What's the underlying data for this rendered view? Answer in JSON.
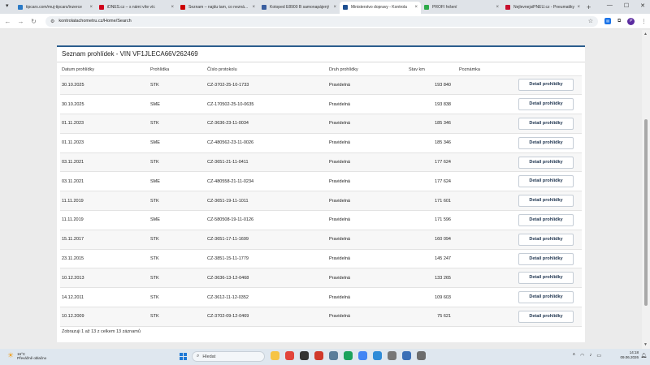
{
  "browser": {
    "tabs": [
      {
        "title": "tipcars.com/muj-tipcars/inzerce",
        "color": "#2a7ac6"
      },
      {
        "title": "iDNES.cz – s námi víte víc",
        "color": "#d0021b"
      },
      {
        "title": "Seznam – najdu tam, co nezná...",
        "color": "#cc0000"
      },
      {
        "title": "Kotoped E8900 B samonapájený",
        "color": "#3a5fa0"
      },
      {
        "title": "Ministerstvo dopravy - Kontrola",
        "color": "#1d4f91"
      },
      {
        "title": "PROFI řešení",
        "color": "#2eaa4a"
      },
      {
        "title": "NejlevnejsiPNEU.cz - Pneumatiky",
        "color": "#c8102e"
      }
    ],
    "url": "kontrolatachometru.cz/Home/Search",
    "profile_initial": "P"
  },
  "panel": {
    "title": "Seznam prohlídek - VIN VF1JLECA66V262469",
    "columns": [
      "Datum prohlídky",
      "Prohlídka",
      "Číslo protokolu",
      "Druh prohlídky",
      "Stav km",
      "Poznámka",
      ""
    ],
    "rows": [
      {
        "date": "30.10.2025",
        "type": "STK",
        "protocol": "CZ-3702-25-10-1733",
        "kind": "Pravidelná",
        "km": "193 840",
        "note": "",
        "action": "Detail prohlídky"
      },
      {
        "date": "30.10.2025",
        "type": "SME",
        "protocol": "CZ-170502-25-10-0635",
        "kind": "Pravidelná",
        "km": "193 838",
        "note": "",
        "action": "Detail prohlídky"
      },
      {
        "date": "01.11.2023",
        "type": "STK",
        "protocol": "CZ-3636-23-11-0034",
        "kind": "Pravidelná",
        "km": "185 346",
        "note": "",
        "action": "Detail prohlídky"
      },
      {
        "date": "01.11.2023",
        "type": "SME",
        "protocol": "CZ-480562-23-11-0026",
        "kind": "Pravidelná",
        "km": "185 346",
        "note": "",
        "action": "Detail prohlídky"
      },
      {
        "date": "03.11.2021",
        "type": "STK",
        "protocol": "CZ-3651-21-11-0411",
        "kind": "Pravidelná",
        "km": "177 624",
        "note": "",
        "action": "Detail prohlídky"
      },
      {
        "date": "03.11.2021",
        "type": "SME",
        "protocol": "CZ-480558-21-11-0234",
        "kind": "Pravidelná",
        "km": "177 624",
        "note": "",
        "action": "Detail prohlídky"
      },
      {
        "date": "11.11.2019",
        "type": "STK",
        "protocol": "CZ-3651-19-11-1011",
        "kind": "Pravidelná",
        "km": "171 601",
        "note": "",
        "action": "Detail prohlídky"
      },
      {
        "date": "11.11.2019",
        "type": "SME",
        "protocol": "CZ-580508-19-11-0126",
        "kind": "Pravidelná",
        "km": "171 596",
        "note": "",
        "action": "Detail prohlídky"
      },
      {
        "date": "15.11.2017",
        "type": "STK",
        "protocol": "CZ-3651-17-11-1699",
        "kind": "Pravidelná",
        "km": "160 094",
        "note": "",
        "action": "Detail prohlídky"
      },
      {
        "date": "23.11.2015",
        "type": "STK",
        "protocol": "CZ-3851-15-11-1779",
        "kind": "Pravidelná",
        "km": "145 247",
        "note": "",
        "action": "Detail prohlídky"
      },
      {
        "date": "10.12.2013",
        "type": "STK",
        "protocol": "CZ-3636-13-12-0468",
        "kind": "Pravidelná",
        "km": "133 265",
        "note": "",
        "action": "Detail prohlídky"
      },
      {
        "date": "14.12.2011",
        "type": "STK",
        "protocol": "CZ-3612-11-12-0352",
        "kind": "Pravidelná",
        "km": "109 603",
        "note": "",
        "action": "Detail prohlídky"
      },
      {
        "date": "10.12.2009",
        "type": "STK",
        "protocol": "CZ-3702-09-12-0469",
        "kind": "Pravidelná",
        "km": "75 621",
        "note": "",
        "action": "Detail prohlídky"
      }
    ],
    "footer": "Zobrazuji 1 až 13 z celkem 13 záznamů"
  },
  "taskbar": {
    "weather_temp": "16°C",
    "weather_desc": "Převážně oblačno",
    "search_placeholder": "Hledat",
    "time": "14:18",
    "date": "09.06.2026"
  }
}
